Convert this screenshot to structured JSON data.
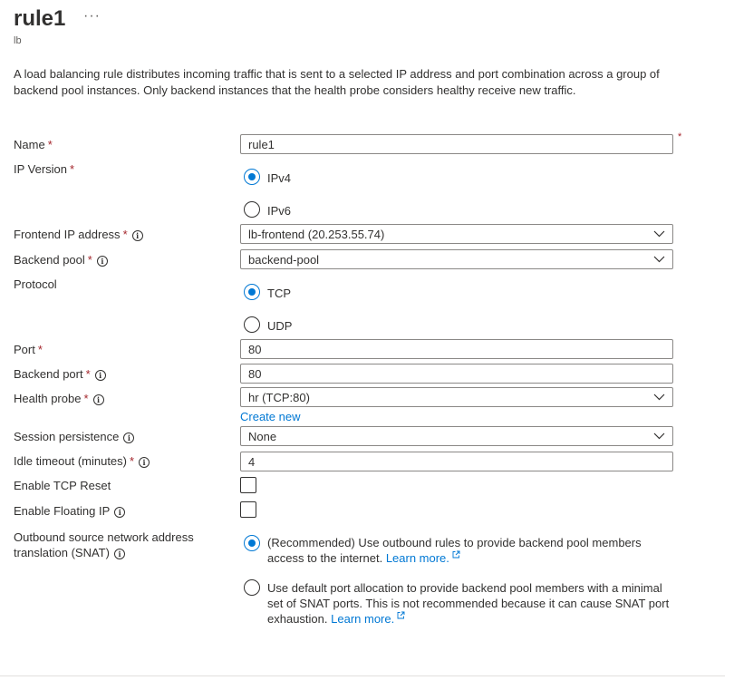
{
  "header": {
    "title": "rule1",
    "more_label": "···",
    "subtitle": "lb"
  },
  "description": "A load balancing rule distributes incoming traffic that is sent to a selected IP address and port combination across a group of backend pool instances. Only backend instances that the health probe considers healthy receive new traffic.",
  "required_mark": "*",
  "info_glyph": "i",
  "form": {
    "name": {
      "label": "Name",
      "value": "rule1"
    },
    "ip_version": {
      "label": "IP Version",
      "options": [
        "IPv4",
        "IPv6"
      ],
      "selected": "IPv4"
    },
    "frontend_ip": {
      "label": "Frontend IP address",
      "value": "lb-frontend (20.253.55.74)"
    },
    "backend_pool": {
      "label": "Backend pool",
      "value": "backend-pool"
    },
    "protocol": {
      "label": "Protocol",
      "options": [
        "TCP",
        "UDP"
      ],
      "selected": "TCP"
    },
    "port": {
      "label": "Port",
      "value": "80"
    },
    "backend_port": {
      "label": "Backend port",
      "value": "80"
    },
    "health_probe": {
      "label": "Health probe",
      "value": "hr (TCP:80)",
      "create_new": "Create new"
    },
    "session_persistence": {
      "label": "Session persistence",
      "value": "None"
    },
    "idle_timeout": {
      "label": "Idle timeout (minutes)",
      "value": "4"
    },
    "enable_tcp_reset": {
      "label": "Enable TCP Reset",
      "checked": false
    },
    "enable_floating_ip": {
      "label": "Enable Floating IP",
      "checked": false
    },
    "snat": {
      "label_line1": "Outbound source network address",
      "label_line2": "translation (SNAT)",
      "option1_text": "(Recommended) Use outbound rules to provide backend pool members access to the internet.",
      "option1_link": "Learn more.",
      "option2_text": "Use default port allocation to provide backend pool members with a minimal set of SNAT ports. This is not recommended because it can cause SNAT port exhaustion.",
      "option2_link": "Learn more.",
      "selected": "option1"
    }
  },
  "colors": {
    "accent": "#0078d4",
    "required": "#a4262c",
    "border": "#8a8886",
    "text": "#323130"
  }
}
